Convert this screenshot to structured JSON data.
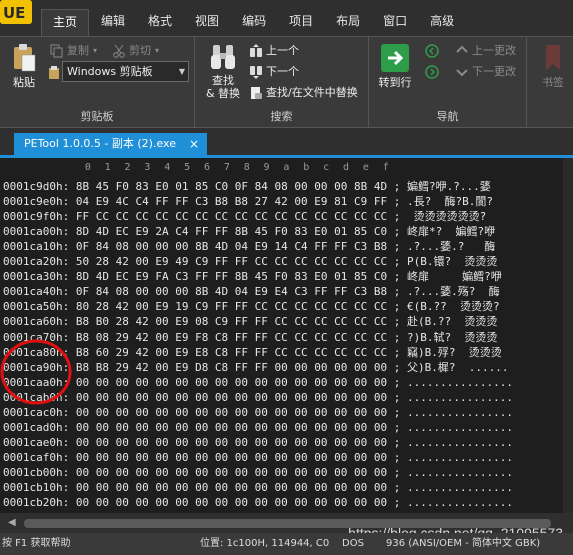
{
  "menu": {
    "tabs": [
      "主页",
      "编辑",
      "格式",
      "视图",
      "编码",
      "项目",
      "布局",
      "窗口",
      "高级"
    ],
    "active_tab": "主页"
  },
  "ribbon": {
    "clipboard": {
      "paste_label": "粘贴",
      "copy_label": "复制",
      "cut_label": "剪切",
      "clipboard_select_value": "Windows 剪贴板",
      "group_label": "剪贴板"
    },
    "search": {
      "find_replace_line1": "查找",
      "find_replace_line2": "& 替换",
      "prev_label": "上一个",
      "next_label": "下一个",
      "find_in_files_label": "查找/在文件中替换",
      "group_label": "搜索"
    },
    "navigation": {
      "goto_label": "转到行",
      "prev_change_label": "上一更改",
      "next_change_label": "下一更改",
      "group_label": "导航"
    },
    "bookmarks": {
      "label": "书签"
    }
  },
  "document": {
    "tab_title": "PETool 1.0.0.5 - 副本 (2).exe",
    "close_glyph": "×"
  },
  "hex": {
    "ruler": [
      "0",
      "1",
      "2",
      "3",
      "4",
      "5",
      "6",
      "7",
      "8",
      "9",
      "a",
      "b",
      "c",
      "d",
      "e",
      "f"
    ],
    "rows": [
      {
        "addr": "0001c9d0h:",
        "bytes": "8B 45 F0 83 E0 01 85 C0 0F 84 08 00 00 00 8B 4D",
        "ascii": "; 媥鳕?咿.?...婱"
      },
      {
        "addr": "0001c9e0h:",
        "bytes": "04 E9 4C C4 FF FF C3 B8 B8 27 42 00 E9 81 C9 FF",
        "ascii": "; .長?  酶?B.閬?"
      },
      {
        "addr": "0001c9f0h:",
        "bytes": "FF CC CC CC CC CC CC CC CC CC CC CC CC CC CC CC",
        "ascii": ";  烫烫烫烫烫烫?"
      },
      {
        "addr": "0001ca00h:",
        "bytes": "8D 4D EC E9 2A C4 FF FF 8B 45 F0 83 E0 01 85 C0",
        "ascii": "; 峂扉*?  媥鳕?咿"
      },
      {
        "addr": "0001ca10h:",
        "bytes": "0F 84 08 00 00 00 8B 4D 04 E9 14 C4 FF FF C3 B8",
        "ascii": "; .?...婱.?   酶"
      },
      {
        "addr": "0001ca20h:",
        "bytes": "50 28 42 00 E9 49 C9 FF FF CC CC CC CC CC CC CC",
        "ascii": "; P(B.镮?  烫烫烫"
      },
      {
        "addr": "0001ca30h:",
        "bytes": "8D 4D EC E9 FA C3 FF FF 8B 45 F0 83 E0 01 85 C0",
        "ascii": "; 峂扉     媥鳕?咿"
      },
      {
        "addr": "0001ca40h:",
        "bytes": "0F 84 08 00 00 00 8B 4D 04 E9 E4 C3 FF FF C3 B8",
        "ascii": "; .?...婱.殇?  酶"
      },
      {
        "addr": "0001ca50h:",
        "bytes": "80 28 42 00 E9 19 C9 FF FF CC CC CC CC CC CC CC",
        "ascii": "; €(B.??  烫烫烫?"
      },
      {
        "addr": "0001ca60h:",
        "bytes": "B8 B0 28 42 00 E9 08 C9 FF FF CC CC CC CC CC CC",
        "ascii": "; 赴(B.??  烫烫烫"
      },
      {
        "addr": "0001ca70h:",
        "bytes": "B8 08 29 42 00 E9 F8 C8 FF FF CC CC CC CC CC CC",
        "ascii": "; ?)B.轼?  烫烫烫"
      },
      {
        "addr": "0001ca80h:",
        "bytes": "B8 60 29 42 00 E9 E8 C8 FF FF CC CC CC CC CC CC",
        "ascii": "; 竊)B.殍?  烫烫烫"
      },
      {
        "addr": "0001ca90h:",
        "bytes": "B8 B8 29 42 00 E9 D8 C8 FF FF 00 00 00 00 00 00",
        "ascii": "; 父)B.樨?  ......"
      },
      {
        "addr": "0001caa0h:",
        "bytes": "00 00 00 00 00 00 00 00 00 00 00 00 00 00 00 00",
        "ascii": "; ................"
      },
      {
        "addr": "0001cab0h:",
        "bytes": "00 00 00 00 00 00 00 00 00 00 00 00 00 00 00 00",
        "ascii": "; ................"
      },
      {
        "addr": "0001cac0h:",
        "bytes": "00 00 00 00 00 00 00 00 00 00 00 00 00 00 00 00",
        "ascii": "; ................"
      },
      {
        "addr": "0001cad0h:",
        "bytes": "00 00 00 00 00 00 00 00 00 00 00 00 00 00 00 00",
        "ascii": "; ................"
      },
      {
        "addr": "0001cae0h:",
        "bytes": "00 00 00 00 00 00 00 00 00 00 00 00 00 00 00 00",
        "ascii": "; ................"
      },
      {
        "addr": "0001caf0h:",
        "bytes": "00 00 00 00 00 00 00 00 00 00 00 00 00 00 00 00",
        "ascii": "; ................"
      },
      {
        "addr": "0001cb00h:",
        "bytes": "00 00 00 00 00 00 00 00 00 00 00 00 00 00 00 00",
        "ascii": "; ................"
      },
      {
        "addr": "0001cb10h:",
        "bytes": "00 00 00 00 00 00 00 00 00 00 00 00 00 00 00 00",
        "ascii": "; ................"
      },
      {
        "addr": "0001cb20h:",
        "bytes": "00 00 00 00 00 00 00 00 00 00 00 00 00 00 00 00",
        "ascii": "; ................"
      }
    ]
  },
  "status": {
    "help": "按 F1 获取帮助",
    "position": "位置: 1c100H, 114944, C0",
    "line_ending": "DOS",
    "encoding": "936  (ANSI/OEM - 简体中文 GBK)"
  },
  "watermark": "https://blog.csdn.net/qq_21095573",
  "colors": {
    "accent": "#1f8fd8",
    "annotation": "#e01010",
    "goto_green": "#2e9d4a",
    "logo_yellow": "#f2c200"
  }
}
